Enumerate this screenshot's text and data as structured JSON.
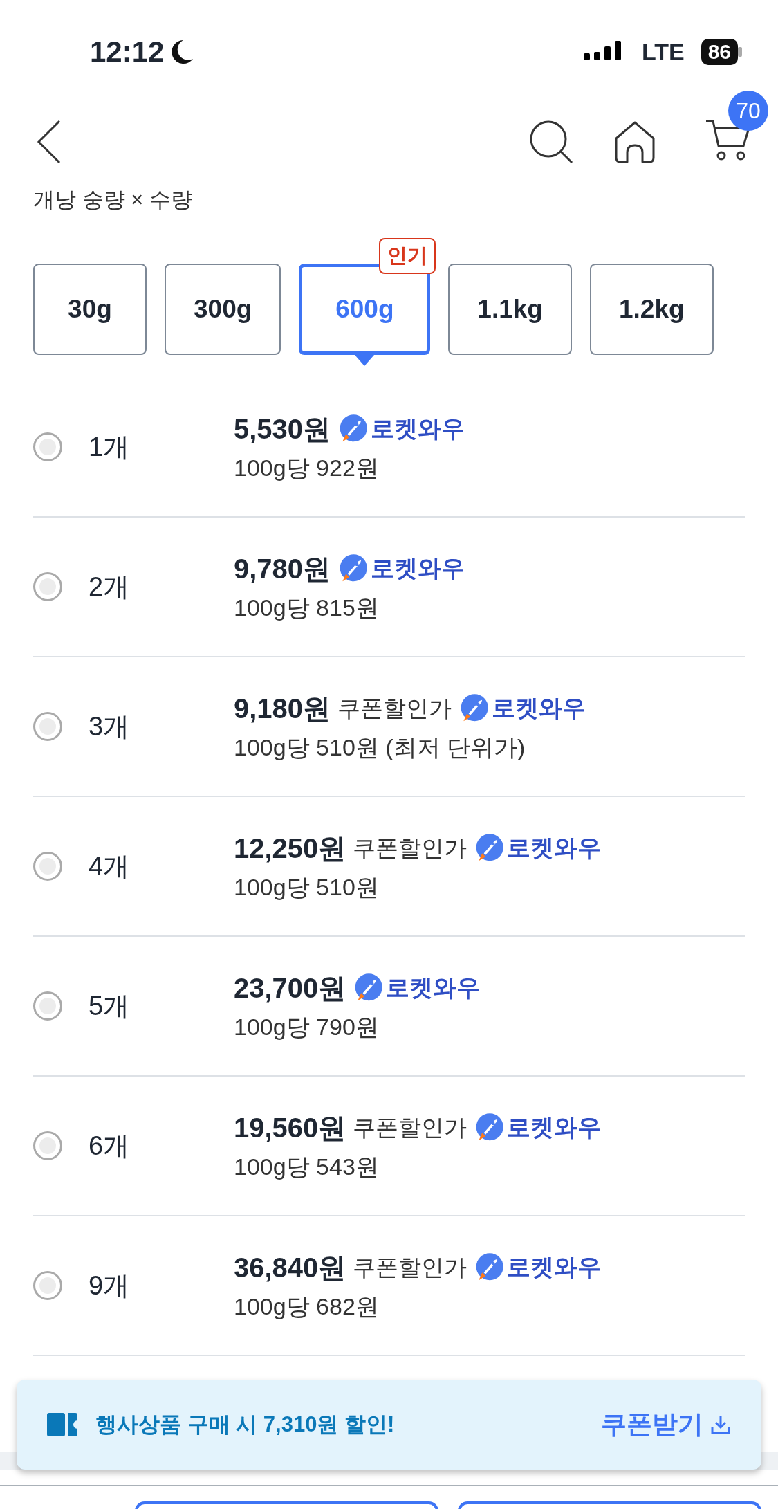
{
  "status_bar": {
    "time": "12:12",
    "network": "LTE",
    "battery": "86"
  },
  "nav": {
    "cart_count": "70"
  },
  "option_label": "개낭 숭량 × 수량",
  "weights": [
    {
      "label": "30g",
      "selected": false
    },
    {
      "label": "300g",
      "selected": false
    },
    {
      "label": "600g",
      "selected": true,
      "badge": "인기"
    },
    {
      "label": "1.1kg",
      "selected": false
    },
    {
      "label": "1.2kg",
      "selected": false
    }
  ],
  "quantities": [
    {
      "qty": "1개",
      "selected": false,
      "price": "5,530원",
      "tag": "로켓와우",
      "unit_price": "100g당 922원"
    },
    {
      "qty": "2개",
      "selected": false,
      "price": "9,780원",
      "tag": "로켓와우",
      "unit_price": "100g당 815원"
    },
    {
      "qty": "3개",
      "selected": false,
      "price": "9,180원",
      "note": "쿠폰할인가",
      "tag": "로켓와우",
      "unit_price": "100g당 510원 (최저 단위가)"
    },
    {
      "qty": "4개",
      "selected": false,
      "price": "12,250원",
      "note": "쿠폰할인가",
      "tag": "로켓와우",
      "unit_price": "100g당 510원"
    },
    {
      "qty": "5개",
      "selected": false,
      "price": "23,700원",
      "tag": "로켓와우",
      "unit_price": "100g당 790원"
    },
    {
      "qty": "6개",
      "selected": false,
      "price": "19,560원",
      "note": "쿠폰할인가",
      "tag": "로켓와우",
      "unit_price": "100g당 543원"
    },
    {
      "qty": "9개",
      "selected": false,
      "price": "36,840원",
      "note": "쿠폰할인가",
      "tag": "로켓와우",
      "unit_price": "100g당 682원"
    }
  ],
  "coupon_banner": {
    "text": "행사상품 구매 시 7,310원 할인!",
    "action": "쿠폰받기"
  }
}
